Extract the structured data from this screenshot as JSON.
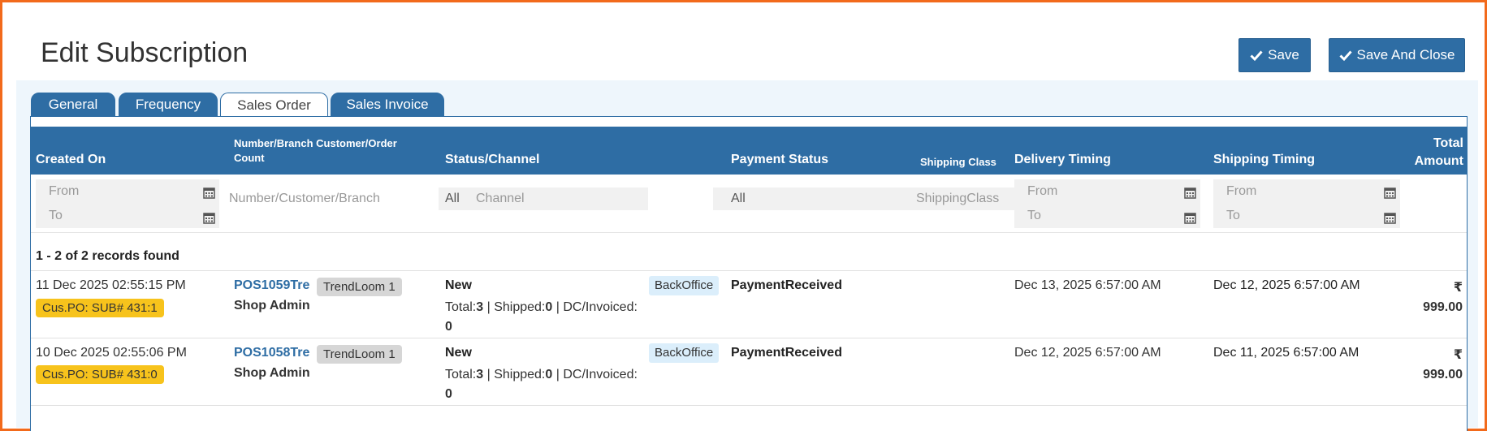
{
  "page": {
    "title": "Edit Subscription"
  },
  "toolbar": {
    "save_label": "Save",
    "save_close_label": "Save And Close"
  },
  "tabs": [
    {
      "label": "General",
      "active": false
    },
    {
      "label": "Frequency",
      "active": false
    },
    {
      "label": "Sales Order",
      "active": true
    },
    {
      "label": "Sales Invoice",
      "active": false
    }
  ],
  "columns": {
    "created_on": "Created On",
    "number_branch": "Number/Branch Customer/Order Count",
    "status_channel": "Status/Channel",
    "payment_status": "Payment Status",
    "shipping_class": "Shipping Class",
    "delivery_timing": "Delivery Timing",
    "shipping_timing": "Shipping Timing",
    "total_amount_1": "Total",
    "total_amount_2": "Amount"
  },
  "filters": {
    "created_from": "From",
    "created_to": "To",
    "number_customer_branch": "Number/Customer/Branch",
    "status_value": "All",
    "channel": "Channel",
    "payment_value": "All",
    "shipping_class": "ShippingClass",
    "delivery_from": "From",
    "delivery_to": "To",
    "shipping_from": "From",
    "shipping_to": "To"
  },
  "records_found": "1 - 2 of 2 records found",
  "rows": [
    {
      "created_on": "11 Dec 2025 02:55:15 PM",
      "po_badge": "Cus.PO:  SUB# 431:1",
      "number": "POS1059Tre",
      "branch_badge": "TrendLoom 1",
      "customer": "Shop Admin",
      "status": "New",
      "total_label": "Total:",
      "total_count": "3",
      "shipped_label": " | Shipped:",
      "shipped_count": "0",
      "dc_label": " | DC/Invoiced:",
      "dc_count": "0",
      "channel_badge": "BackOffice",
      "payment_status": "PaymentReceived",
      "delivery_timing": "Dec 13, 2025 6:57:00 AM",
      "shipping_timing": "Dec 12, 2025 6:57:00 AM",
      "currency": "₹",
      "amount": "999.00"
    },
    {
      "created_on": "10 Dec 2025 02:55:06 PM",
      "po_badge": "Cus.PO:  SUB# 431:0",
      "number": "POS1058Tre",
      "branch_badge": "TrendLoom 1",
      "customer": "Shop Admin",
      "status": "New",
      "total_label": "Total:",
      "total_count": "3",
      "shipped_label": " | Shipped:",
      "shipped_count": "0",
      "dc_label": " | DC/Invoiced:",
      "dc_count": "0",
      "channel_badge": "BackOffice",
      "payment_status": "PaymentReceived",
      "delivery_timing": "Dec 12, 2025 6:57:00 AM",
      "shipping_timing": "Dec 11, 2025 6:57:00 AM",
      "currency": "₹",
      "amount": "999.00"
    }
  ],
  "colors": {
    "primary": "#2e6da4",
    "frame": "#f26a1b",
    "badge_yellow": "#f7c31c",
    "badge_blue": "#dbeefb"
  }
}
